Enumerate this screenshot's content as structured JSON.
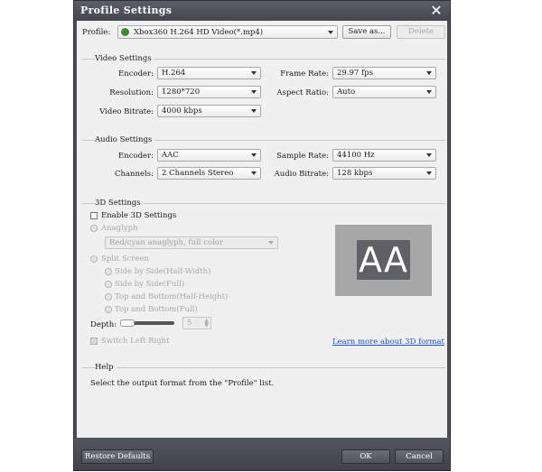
{
  "window": {
    "title": "Profile Settings",
    "close_glyph": "✕"
  },
  "profile": {
    "label": "Profile:",
    "value": "Xbox360 H.264 HD Video(*.mp4)",
    "icon": "xbox-icon",
    "icon_color": "#3a8d2f",
    "save_as": "Save as...",
    "delete": "Delete"
  },
  "video": {
    "title": "Video Settings",
    "encoder": {
      "label": "Encoder:",
      "value": "H.264"
    },
    "frame_rate": {
      "label": "Frame Rate:",
      "value": "29.97 fps"
    },
    "resolution": {
      "label": "Resolution:",
      "value": "1280*720"
    },
    "aspect_ratio": {
      "label": "Aspect Ratio:",
      "value": "Auto"
    },
    "bitrate": {
      "label": "Video Bitrate:",
      "value": "4000 kbps"
    }
  },
  "audio": {
    "title": "Audio Settings",
    "encoder": {
      "label": "Encoder:",
      "value": "AAC"
    },
    "sample_rate": {
      "label": "Sample Rate:",
      "value": "44100 Hz"
    },
    "channels": {
      "label": "Channels:",
      "value": "2 Channels Stereo"
    },
    "bitrate": {
      "label": "Audio Bitrate:",
      "value": "128 kbps"
    }
  },
  "three_d": {
    "title": "3D Settings",
    "enable": {
      "label": "Enable 3D Settings",
      "checked": false
    },
    "anaglyph": {
      "label": "Anaglyph",
      "value": "Red/cyan anaglyph, full color"
    },
    "split": {
      "label": "Split Screen",
      "options": [
        "Side by Side(Half-Width)",
        "Side by Side(Full)",
        "Top and Bottom(Half-Height)",
        "Top and Bottom(Full)"
      ]
    },
    "depth": {
      "label": "Depth:",
      "value": "5",
      "level": 0.1
    },
    "switch": {
      "label": "Switch Left Right"
    },
    "preview_text": "AA",
    "learn_more": "Learn more about 3D format"
  },
  "help": {
    "title": "Help",
    "text": "Select the output format from the \"Profile\" list."
  },
  "footer": {
    "restore": "Restore Defaults",
    "ok": "OK",
    "cancel": "Cancel"
  }
}
